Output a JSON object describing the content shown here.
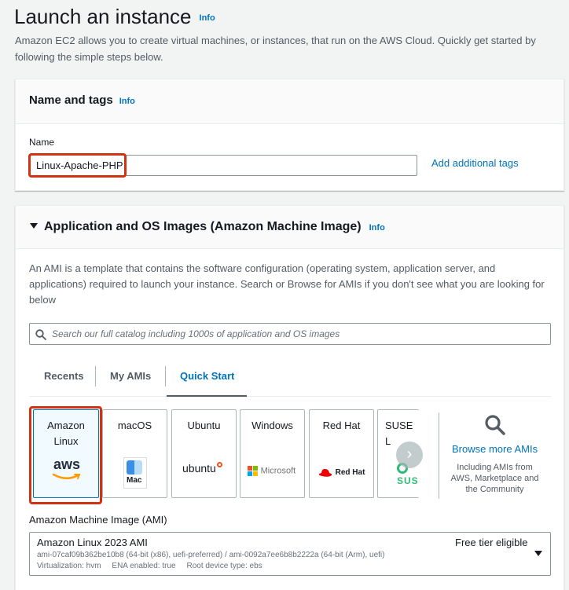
{
  "header": {
    "title": "Launch an instance",
    "info": "Info",
    "description": "Amazon EC2 allows you to create virtual machines, or instances, that run on the AWS Cloud. Quickly get started by following the simple steps below."
  },
  "name_tags": {
    "title": "Name and tags",
    "info": "Info",
    "name_label": "Name",
    "name_value": "Linux-Apache-PHP",
    "add_tags": "Add additional tags"
  },
  "ami_section": {
    "title": "Application and OS Images (Amazon Machine Image)",
    "info": "Info",
    "description": "An AMI is a template that contains the software configuration (operating system, application server, and applications) required to launch your instance. Search or Browse for AMIs if you don't see what you are looking for below",
    "search_placeholder": "Search our full catalog including 1000s of application and OS images",
    "tabs": [
      "Recents",
      "My AMIs",
      "Quick Start"
    ],
    "active_tab": "Quick Start",
    "os_cards": [
      {
        "label": "Amazon Linux",
        "logo": "aws",
        "selected": true
      },
      {
        "label": "macOS",
        "logo": "Mac"
      },
      {
        "label": "Ubuntu",
        "logo": "ubuntu"
      },
      {
        "label": "Windows",
        "logo": "Microsoft"
      },
      {
        "label": "Red Hat",
        "logo": "Red Hat"
      },
      {
        "label": "SUSE L",
        "logo": "SUS"
      }
    ],
    "browse_more": "Browse more AMIs",
    "browse_sub": "Including AMIs from AWS, Marketplace and the Community",
    "ami_label": "Amazon Machine Image (AMI)",
    "ami_name": "Amazon Linux 2023 AMI",
    "ami_badge": "Free tier eligible",
    "ami_ids": "ami-07caf09b362be10b8 (64-bit (x86), uefi-preferred) / ami-0092a7ee6b8b2222a (64-bit (Arm), uefi)",
    "ami_meta": "Virtualization: hvm     ENA enabled: true     Root device type: ebs"
  },
  "colors": {
    "accent": "#0073bb",
    "highlight": "#d13212",
    "aws_orange": "#ff9900",
    "ubuntu_orange": "#e95420",
    "redhat_red": "#ee0000",
    "suse_green": "#30ba78"
  }
}
